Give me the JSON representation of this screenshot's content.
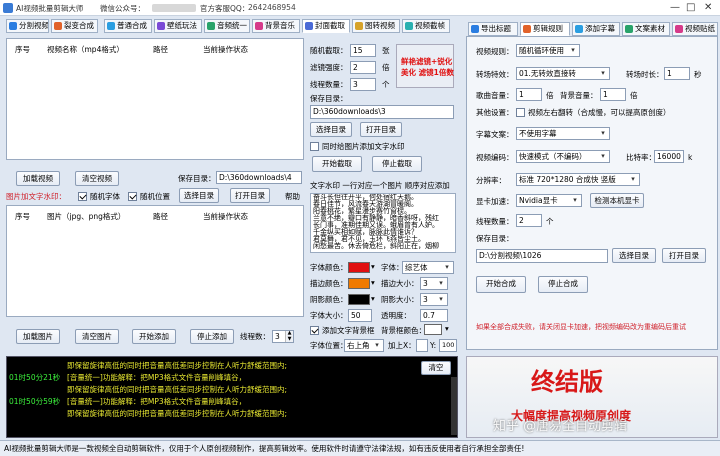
{
  "window": {
    "title": "AI视频批量剪辑大师",
    "wechat": "微信公众号：",
    "official_qq": "官方客服QQ：",
    "qq_value": "2642468954"
  },
  "top_tabs": [
    {
      "label": "分割视频",
      "icon": "split-icon",
      "color": "#2a7de1"
    },
    {
      "label": "裂变合成",
      "icon": "fission-icon",
      "color": "#e1622a"
    },
    {
      "label": "普通合成",
      "icon": "merge-icon",
      "color": "#2a9ee1"
    },
    {
      "label": "壁纸玩法",
      "icon": "wallpaper-icon",
      "color": "#7a4ad6"
    },
    {
      "label": "音频统一",
      "icon": "audio-icon",
      "color": "#29a36a"
    },
    {
      "label": "背景音乐",
      "icon": "music-icon",
      "color": "#d63a8a"
    },
    {
      "label": "封面截取",
      "icon": "cover-icon",
      "color": "#4a6ad6"
    },
    {
      "label": "图转视频",
      "icon": "image-video-icon",
      "color": "#d6a22a"
    },
    {
      "label": "视频截帧",
      "icon": "frame-icon",
      "color": "#2ab0b0"
    }
  ],
  "right_tabs": [
    {
      "label": "导出标题",
      "icon": "export-title-icon",
      "color": "#2a7de1"
    },
    {
      "label": "剪辑规则",
      "icon": "rules-icon",
      "color": "#e1622a"
    },
    {
      "label": "添加字幕",
      "icon": "subtitle-icon",
      "color": "#2a9ee1"
    },
    {
      "label": "文案素材",
      "icon": "copy-icon",
      "color": "#29a36a"
    },
    {
      "label": "视频贴纸",
      "icon": "sticker-icon",
      "color": "#d63a8a"
    }
  ],
  "video_list": {
    "headers": [
      "序号",
      "视频名称（mp4格式）",
      "路径",
      "当前操作状态"
    ]
  },
  "video_buttons": {
    "add": "加载视频",
    "clear": "清空视频",
    "save_dir_label": "保存目录：",
    "save_dir_value": "D:\\360downloads\\4"
  },
  "image_watermark": {
    "label": "图片加文字水印：",
    "random_font": "随机字体",
    "random_position": "随机位置",
    "select_dir": "选择目录",
    "open_dir": "打开目录",
    "help": "帮助"
  },
  "image_list": {
    "headers": [
      "序号",
      "图片（jpg、png格式）",
      "路径",
      "当前操作状态"
    ]
  },
  "image_buttons": {
    "add": "加载图片",
    "clear": "清空图片",
    "start": "开始添加",
    "stop": "停止添加",
    "threads_label": "线程数：",
    "threads_value": "3"
  },
  "capture": {
    "random_label": "随机截取：",
    "random_value": "15",
    "random_unit": "张",
    "filter_label": "滤镜强度：",
    "filter_value": "2",
    "filter_unit": "倍",
    "threads_label": "线程数量：",
    "threads_value": "3",
    "threads_unit": "个",
    "save_label": "保存目录：",
    "save_value": "D:\\360downloads\\3",
    "select_dir": "选择目录",
    "open_dir": "打开目录",
    "sync_watermark": "同时给图片添加文字水印",
    "start": "开始截取",
    "stop": "停止截取",
    "preview_line1": "鲜艳滤镜+锐化",
    "preview_line2": "美化 滤镜1倍数"
  },
  "text_wm": {
    "title": "文字水印 一行对应一个图片 顺序对应添加",
    "lines": [
      "奋斗长但往开平，何处宿红天鹅。",
      "春日佳节，风流春天游湖冒暖阁。",
      "阳春桃花，繁星漫步赛竹窗棂。",
      "兰意不绝，瓣口有静静，暗香斜呀，残红",
      "长门事，准期佳期又误。蛾眉曾有人妒。",
      "千金纵买相如赋，脉脉此情谁诉？",
      "君莫舞，君不见，玉环飞燕皆尘土。",
      "闲愁最苦。休去倚危栏，斜阳正在，烟柳"
    ]
  },
  "text_style": {
    "font_color_label": "字体颜色：",
    "font_color": "#e01010",
    "font_label": "字体：",
    "font_value": "综艺体",
    "stroke_color_label": "描边颜色：",
    "stroke_color": "#f07a00",
    "stroke_size_label": "描边大小：",
    "stroke_size_value": "3",
    "shadow_color_label": "阴影颜色：",
    "shadow_color": "#000000",
    "shadow_size_label": "阴影大小：",
    "shadow_size_value": "3",
    "font_size_label": "字体大小：",
    "font_size_value": "50",
    "transparency_label": "透明度：",
    "transparency_value": "0.7",
    "add_bg": "添加文字背景框",
    "bg_color_label": "背景框颜色：",
    "bg_color": "#ffffff",
    "position_label": "字体位置：",
    "position_value": "右上角",
    "add_x_label": "加上X：",
    "add_x_value": "",
    "y_label": "Y:",
    "y_value": "100"
  },
  "rules": {
    "split_mode_label": "视频规则：",
    "split_mode_value": "随机循环使用",
    "transition_label": "转场特效：",
    "transition_value": "01.无转效直接转",
    "transition_dur_label": "转场时长：",
    "transition_dur_value": "1",
    "transition_unit": "秒",
    "song_vol_label": "歌曲音量：",
    "song_vol_value": "1",
    "song_vol_unit": "倍",
    "bg_vol_label": "背景音量：",
    "bg_vol_value": "1",
    "bg_vol_unit": "倍",
    "other_label": "其他设置：",
    "flip_label": "视频左右翻转（合成慢，可以提高原创度）",
    "subtitle_label": "字幕文案：",
    "subtitle_value": "不使用字幕",
    "encode_label": "视频编码：",
    "encode_value": "快速模式（不编码）",
    "bitrate_label": "比特率：",
    "bitrate_value": "16000",
    "bitrate_unit": "k",
    "resolution_label": "分辨率：",
    "resolution_value": "标准 720*1280 合成快 竖版",
    "gpu_label": "显卡加速：",
    "gpu_value": "Nvidia显卡",
    "gpu_detect": "检测本机显卡",
    "threads_label": "线程数量：",
    "threads_value": "2",
    "threads_unit": "个",
    "save_label": "保存目录：",
    "save_value": "D:\\分割视频\\1026",
    "select_dir": "选择目录",
    "open_dir": "打开目录",
    "start": "开始合成",
    "stop": "停止合成",
    "warning": "如果全部合成失败，请关闭显卡加速，把视频编码改为重编码后重试"
  },
  "log": {
    "clear": "清空",
    "lines": [
      {
        "time": "",
        "text": "即保留旋律高低的同时把音量高低差同步控制在人听力舒缓范围内;"
      },
      {
        "time": "01时50分21秒",
        "text": "[音量统一]功能解释：把MP3格式文件音量削峰填谷，"
      },
      {
        "time": "",
        "text": "即保留旋律高低的同时把音量高低差同步控制在人听力舒缓范围内;"
      },
      {
        "time": "01时50分59秒",
        "text": "[音量统一]功能解释：把MP3格式文件音量削峰填谷，"
      },
      {
        "time": "",
        "text": "即保留旋律高低的同时把音量高低差同步控制在人听力舒缓范围内;"
      }
    ]
  },
  "promo": {
    "title": "终结版",
    "subtitle": "大幅度提高视频原创度",
    "watermark": "知乎 @唐易全自动剪辑"
  },
  "status": "AI视频批量剪辑大师是一款视频全自动剪辑软件，仅用于个人原创视频制作，提高剪辑效率。使用软件时请遵守法律法规，如有违反使用者自行承担全部责任!"
}
